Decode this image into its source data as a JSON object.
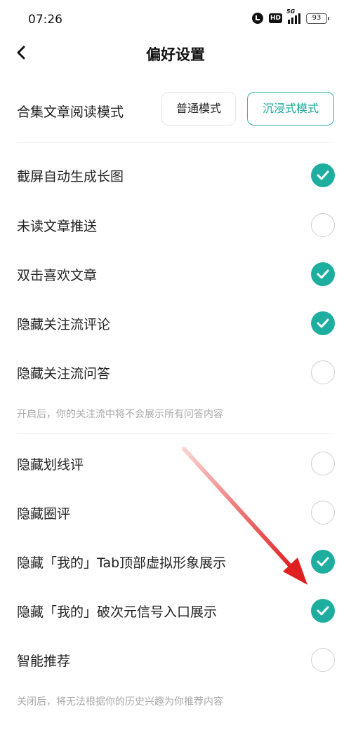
{
  "status_bar": {
    "time": "07:26",
    "signal_label": "5G",
    "battery": "93",
    "icons": [
      "alarm-icon",
      "hd-icon",
      "signal-icon",
      "battery-icon"
    ]
  },
  "nav": {
    "back_icon": "chevron-left-icon",
    "title": "偏好设置"
  },
  "reading_mode": {
    "label": "合集文章阅读模式",
    "options": [
      "普通模式",
      "沉浸式模式"
    ],
    "selected": "沉浸式模式",
    "accent_color": "#2db8a8"
  },
  "settings": [
    {
      "label": "截屏自动生成长图",
      "checked": true
    },
    {
      "label": "未读文章推送",
      "checked": false
    },
    {
      "label": "双击喜欢文章",
      "checked": true
    },
    {
      "label": "隐藏关注流评论",
      "checked": true
    },
    {
      "label": "隐藏关注流问答",
      "checked": false
    },
    {
      "label": "隐藏划线评",
      "checked": false
    },
    {
      "label": "隐藏圈评",
      "checked": false
    },
    {
      "label": "隐藏「我的」Tab顶部虚拟形象展示",
      "checked": true
    },
    {
      "label": "隐藏「我的」破次元信号入口展示",
      "checked": true
    },
    {
      "label": "智能推荐",
      "checked": false
    }
  ],
  "hints": {
    "follow_qa": "开启后，你的关注流中将不会展示所有问答内容",
    "smart_recommend": "关闭后，将无法根据你的历史兴趣为你推荐内容"
  },
  "colors": {
    "check_on": "#1eae9f",
    "annotation_arrow": "#e02020"
  }
}
